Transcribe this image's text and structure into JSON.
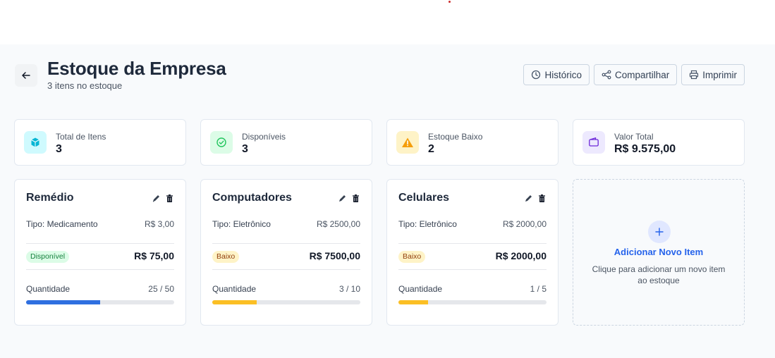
{
  "header": {
    "title": "Estoque da Empresa",
    "subtitle": "3 itens no estoque",
    "actions": [
      {
        "label": "Histórico",
        "icon": "clock-icon"
      },
      {
        "label": "Compartilhar",
        "icon": "share-icon"
      },
      {
        "label": "Imprimir",
        "icon": "printer-icon"
      }
    ]
  },
  "stats": [
    {
      "label": "Total de Itens",
      "value": "3",
      "icon": "box-icon",
      "bg": "#cffafe",
      "color": "#06b6d4"
    },
    {
      "label": "Disponíveis",
      "value": "3",
      "icon": "check-circle-icon",
      "bg": "#dcfce7",
      "color": "#22c55e"
    },
    {
      "label": "Estoque Baixo",
      "value": "2",
      "icon": "warning-icon",
      "bg": "#fef3c7",
      "color": "#f59e0b"
    },
    {
      "label": "Valor Total",
      "value": "R$ 9.575,00",
      "icon": "wallet-icon",
      "bg": "#ede9fe",
      "color": "#7c3aed"
    }
  ],
  "items": [
    {
      "name": "Remédio",
      "type": "Tipo: Medicamento",
      "unit_price": "R$ 3,00",
      "status": "Disponível",
      "status_kind": "ok",
      "total": "R$ 75,00",
      "qty_label": "Quantidade",
      "qty": "25 / 50",
      "fill": 0.5,
      "bar_color": "#2f6fe0"
    },
    {
      "name": "Computadores",
      "type": "Tipo: Eletrônico",
      "unit_price": "R$ 2500,00",
      "status": "Baixo",
      "status_kind": "low",
      "total": "R$ 7500,00",
      "qty_label": "Quantidade",
      "qty": "3 / 10",
      "fill": 0.3,
      "bar_color": "#fbbf24"
    },
    {
      "name": "Celulares",
      "type": "Tipo: Eletrônico",
      "unit_price": "R$ 2000,00",
      "status": "Baixo",
      "status_kind": "low",
      "total": "R$ 2000,00",
      "qty_label": "Quantidade",
      "qty": "1 / 5",
      "fill": 0.2,
      "bar_color": "#fbbf24"
    }
  ],
  "add_card": {
    "title": "Adicionar Novo Item",
    "description": "Clique para adicionar um novo item ao estoque"
  }
}
